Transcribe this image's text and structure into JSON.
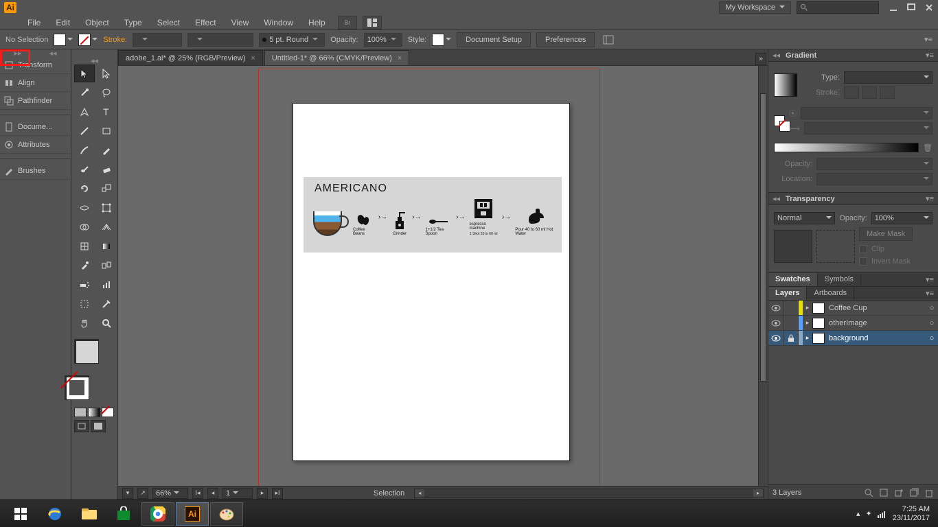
{
  "menu": {
    "items": [
      "File",
      "Edit",
      "Object",
      "Type",
      "Select",
      "Effect",
      "View",
      "Window",
      "Help"
    ]
  },
  "workspace": "My Workspace",
  "control": {
    "selection": "No Selection",
    "strokeLabel": "Stroke:",
    "brush": "5 pt. Round",
    "opacityLabel": "Opacity:",
    "opacity": "100%",
    "styleLabel": "Style:",
    "docSetup": "Document Setup",
    "prefs": "Preferences"
  },
  "leftPanels": [
    "Transform",
    "Align",
    "Pathfinder",
    "Docume...",
    "Attributes",
    "Brushes"
  ],
  "docTabs": [
    {
      "label": "adobe_1.ai* @ 25% (RGB/Preview)",
      "active": false
    },
    {
      "label": "Untitled-1* @ 66% (CMYK/Preview)",
      "active": true
    }
  ],
  "art": {
    "title": "AMERICANO",
    "steps": [
      "Coffee Beans",
      "Grinder",
      "1+1/2 Tea Spoon",
      "espresso machine",
      "Pour 40 to 60 ml Hot Water"
    ],
    "sub": "1 Shot 50 to 60 ml"
  },
  "status": {
    "zoom": "66%",
    "artboard": "1",
    "tool": "Selection"
  },
  "gradient": {
    "panel": "Gradient",
    "typeLabel": "Type:",
    "strokeLabel": "Stroke:",
    "opacityLabel": "Opacity:",
    "locationLabel": "Location:"
  },
  "transparency": {
    "panel": "Transparency",
    "mode": "Normal",
    "opacityLabel": "Opacity:",
    "opacity": "100%",
    "makeMask": "Make Mask",
    "clip": "Clip",
    "invert": "Invert Mask"
  },
  "swatchesTabs": [
    "Swatches",
    "Symbols"
  ],
  "layersTabs": [
    "Layers",
    "Artboards"
  ],
  "layers": [
    {
      "name": "Coffee Cup",
      "color": "#e6e000",
      "locked": false,
      "sel": false
    },
    {
      "name": "otherImage",
      "color": "#5aa0ff",
      "locked": false,
      "sel": false
    },
    {
      "name": "background",
      "color": "#8aa8c8",
      "locked": true,
      "sel": true
    }
  ],
  "layersFooter": "3 Layers",
  "tray": {
    "time": "7:25 AM",
    "date": "23/11/2017"
  }
}
